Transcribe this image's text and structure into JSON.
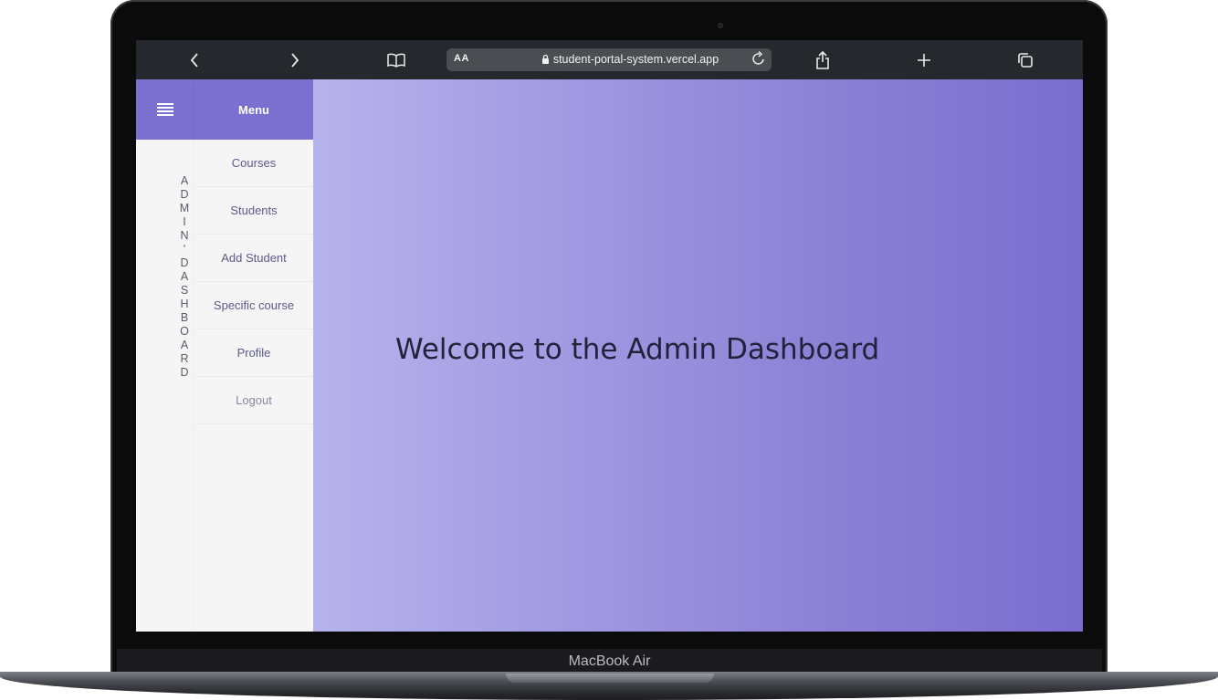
{
  "device": {
    "model_label": "MacBook Air"
  },
  "browser": {
    "address_text_size": "AA",
    "url": "student-portal-system.vercel.app",
    "icons": {
      "back": "chevron-left-icon",
      "forward": "chevron-right-icon",
      "bookmarks": "book-icon",
      "lock": "lock-icon",
      "reload": "reload-icon",
      "share": "share-icon",
      "new_tab": "plus-icon",
      "tabs": "tabs-icon"
    }
  },
  "sidebar": {
    "vertical_title": "ADMIN'DASHBOARD",
    "menu_title": "Menu",
    "items": [
      {
        "label": "Courses"
      },
      {
        "label": "Students"
      },
      {
        "label": "Add Student"
      },
      {
        "label": "Specific course"
      },
      {
        "label": "Profile"
      },
      {
        "label": "Logout"
      }
    ]
  },
  "main": {
    "welcome_text": "Welcome to the Admin Dashboard"
  },
  "colors": {
    "accent": "#7b6fd0",
    "gradient_start": "#b7b3ec",
    "gradient_end": "#7a6dcf",
    "menu_text": "#5c5a8c"
  }
}
